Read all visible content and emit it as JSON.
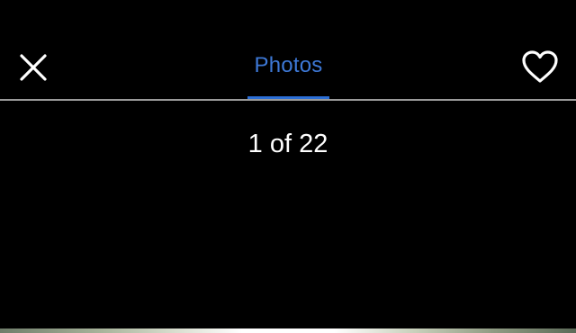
{
  "header": {
    "close_icon": "close-icon",
    "favorite_icon": "heart-outline-icon",
    "tab": {
      "label": "Photos",
      "active": true
    }
  },
  "viewer": {
    "counter": "1 of 22",
    "current_photo": 1,
    "total_photos": 22
  },
  "colors": {
    "background": "#000000",
    "accent": "#2c6fd6",
    "divider": "#9a9a9a",
    "text": "#ffffff"
  }
}
